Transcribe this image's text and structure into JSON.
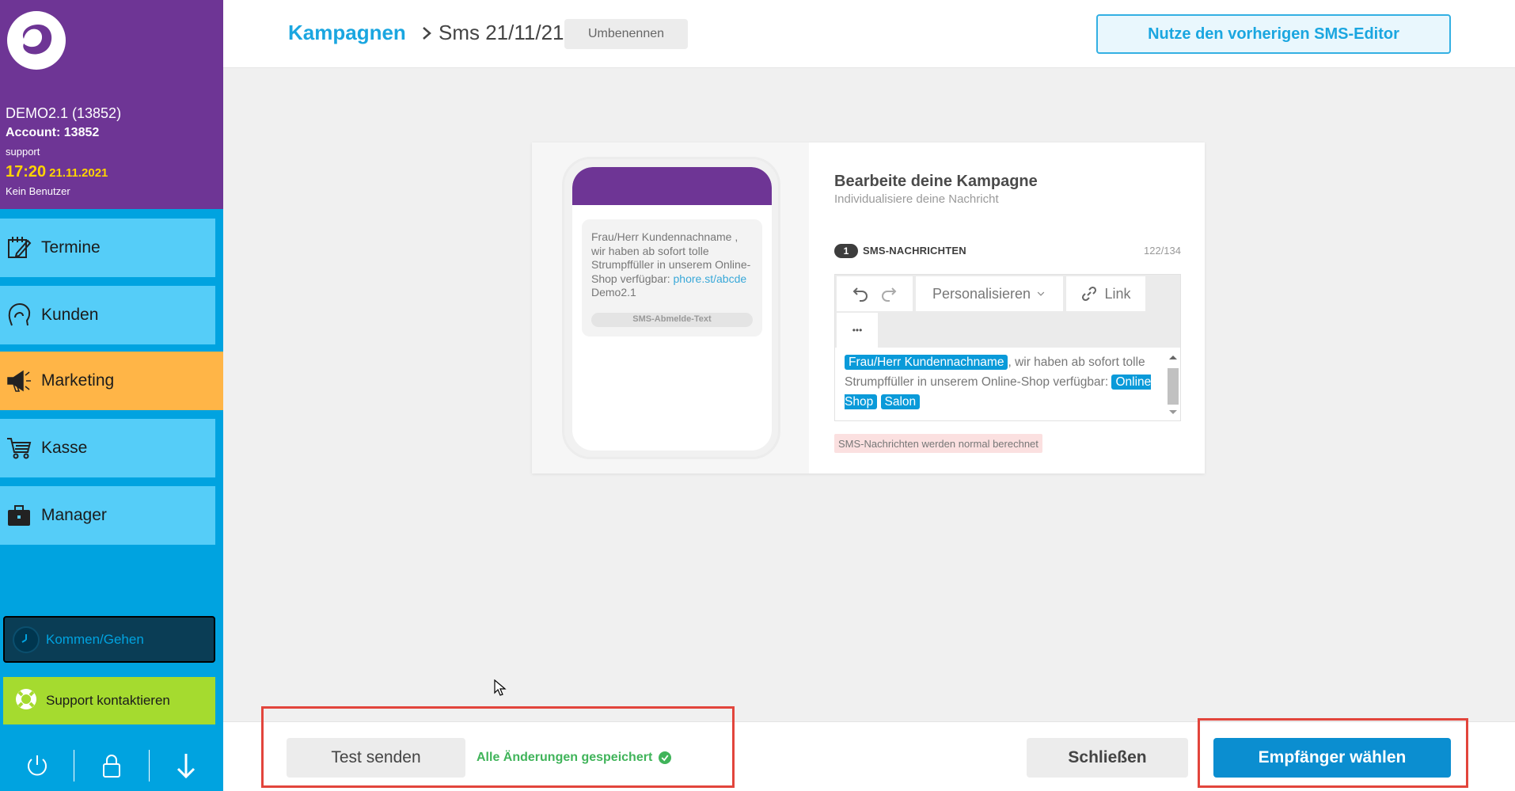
{
  "sidebar": {
    "account": {
      "name": "DEMO2.1 (13852)",
      "number": "Account: 13852",
      "role": "support",
      "time": "17:20",
      "date": "21.11.2021",
      "user": "Kein Benutzer"
    },
    "nav": [
      {
        "label": "Termine",
        "icon": "calendar-edit-icon"
      },
      {
        "label": "Kunden",
        "icon": "customer-head-icon"
      },
      {
        "label": "Marketing",
        "icon": "megaphone-icon"
      },
      {
        "label": "Kasse",
        "icon": "cart-icon"
      },
      {
        "label": "Manager",
        "icon": "briefcase-icon"
      }
    ],
    "active_nav": "Marketing",
    "kommen_label": "Kommen/Gehen",
    "support_label": "Support kontaktieren",
    "bottom_icons": [
      "power-icon",
      "lock-icon",
      "arrow-down-icon"
    ]
  },
  "header": {
    "breadcrumb_root": "Kampagnen",
    "title": "Sms 21/11/21",
    "rename_label": "Umbenennen",
    "old_editor_label": "Nutze den vorherigen SMS-Editor"
  },
  "preview": {
    "message_text": "Frau/Herr Kundennachname , wir haben ab sofort tolle Strumpffüller in unserem Online-Shop verfügbar:",
    "link_text": "phore.st/abcde",
    "link_suffix": " Demo2.1",
    "unsubscribe_label": "SMS-Abmelde-Text"
  },
  "editor": {
    "title": "Bearbeite deine Kampagne",
    "subtitle": "Individualisiere deine Nachricht",
    "sms_count_badge": "1",
    "sms_label": "SMS-NACHRICHTEN",
    "char_count": "122/134",
    "personalize_label": "Personalisieren",
    "link_label": "Link",
    "more_label": "•••",
    "tag_name": "Frau/Herr Kundennachname",
    "text_part1": ", wir haben ab sofort tolle Strumpffüller in unserem Online-Shop verfügbar:",
    "tag_shop": "Online Shop",
    "tag_salon": "Salon",
    "warning": "SMS-Nachrichten werden normal berechnet"
  },
  "footer": {
    "test_label": "Test senden",
    "saved_label": "Alle Änderungen gespeichert",
    "close_label": "Schließen",
    "recipients_label": "Empfänger wählen"
  },
  "colors": {
    "sidebar_purple": "#6e3595",
    "sidebar_blue": "#00a3e0",
    "nav_item": "#55cdf8",
    "nav_active": "#ffb547",
    "primary": "#0b8ed0",
    "support_green": "#a5db2f",
    "highlight_red": "#e2453c"
  }
}
